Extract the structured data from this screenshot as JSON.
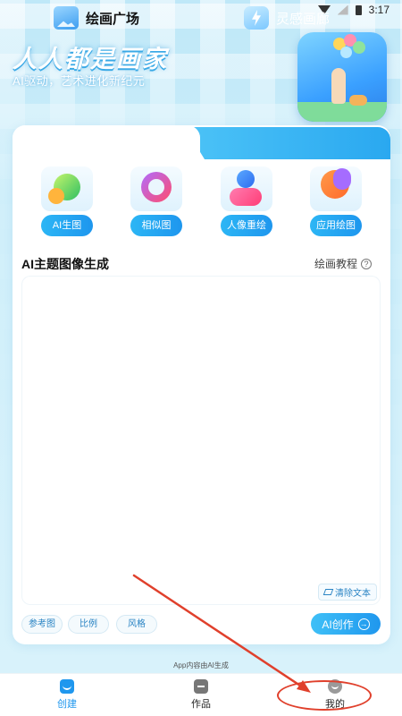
{
  "status_bar": {
    "time": "3:17"
  },
  "hero": {
    "title": "人人都是画家",
    "subtitle": "AI驱动，艺术进化新纪元"
  },
  "tabs": [
    {
      "label": "绘画广场",
      "icon": "image-icon",
      "active": true
    },
    {
      "label": "灵感画廊",
      "icon": "lightning-icon",
      "active": false
    }
  ],
  "features": [
    {
      "label": "AI生图",
      "icon": "leaf-icon"
    },
    {
      "label": "相似图",
      "icon": "refresh-icon"
    },
    {
      "label": "人像重绘",
      "icon": "person-icon"
    },
    {
      "label": "应用绘图",
      "icon": "bulb-icon"
    }
  ],
  "prompt_section": {
    "title": "AI主题图像生成",
    "tutorial_label": "绘画教程",
    "help_glyph": "?",
    "clear_label": "清除文本"
  },
  "options": [
    "参考图",
    "比例",
    "风格"
  ],
  "create_button": {
    "label": "AI创作",
    "arrow": "→"
  },
  "footer_note": "App内容由AI生成",
  "bottom_nav": [
    {
      "label": "创建",
      "active": true
    },
    {
      "label": "作品",
      "active": false
    },
    {
      "label": "我的",
      "active": false
    }
  ],
  "colors": {
    "accent": "#1f97ee",
    "annotation": "#e0402c"
  }
}
